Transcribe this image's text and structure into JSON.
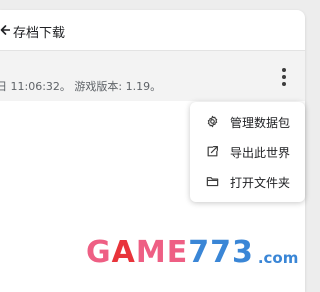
{
  "header": {
    "title": "存档下载"
  },
  "world": {
    "info_text": "日 11:06:32。 游戏版本: 1.19。"
  },
  "menu": {
    "items": [
      {
        "label": "管理数据包",
        "icon": "gear-icon"
      },
      {
        "label": "导出此世界",
        "icon": "export-icon"
      },
      {
        "label": "打开文件夹",
        "icon": "folder-icon"
      }
    ]
  },
  "watermark": {
    "text": "GAME773",
    "domain": ".com"
  },
  "colors": {
    "text": "#202124",
    "muted": "#5f6368",
    "watermark_pink": "#ee5f84",
    "watermark_red": "#e8343b",
    "watermark_blue": "#3a86d6"
  }
}
